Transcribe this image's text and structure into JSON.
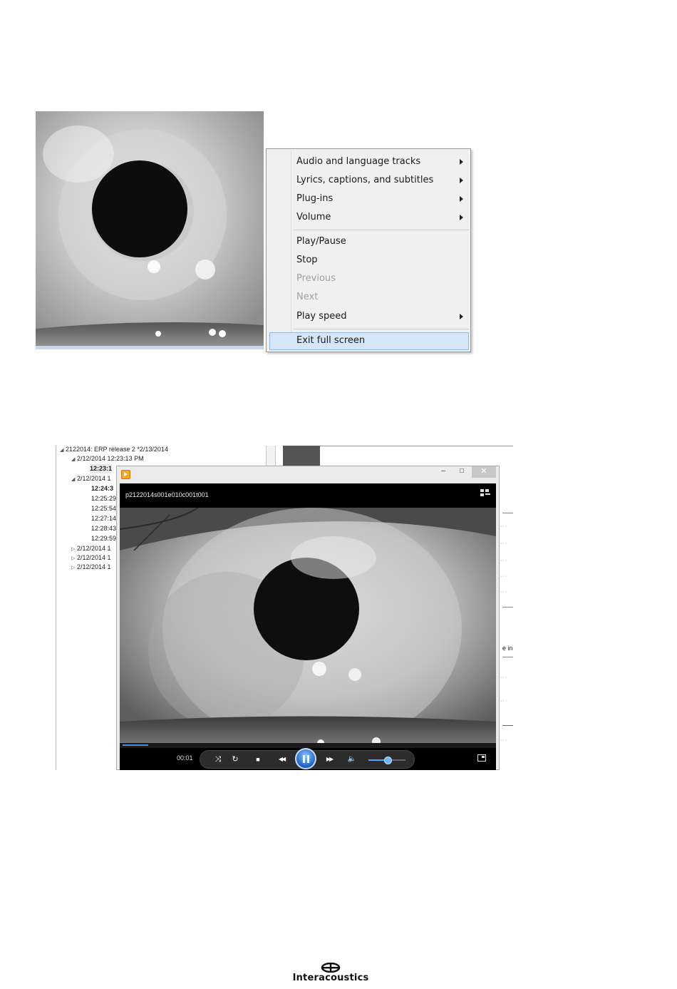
{
  "context_menu": {
    "items": [
      {
        "label": "Audio and language tracks",
        "submenu": true
      },
      {
        "label": "Lyrics, captions, and subtitles",
        "submenu": true
      },
      {
        "label": "Plug-ins",
        "submenu": true
      },
      {
        "label": "Volume",
        "submenu": true
      },
      {
        "label": "Play/Pause"
      },
      {
        "label": "Stop"
      },
      {
        "label": "Previous",
        "disabled": true
      },
      {
        "label": "Next",
        "disabled": true
      },
      {
        "label": "Play speed",
        "submenu": true
      },
      {
        "label": "Exit full screen",
        "highlighted": true
      }
    ]
  },
  "tree": {
    "root": "2122014: ERP release 2 *2/13/2014",
    "session1": "2/12/2014 12:23:13 PM",
    "session1_child": "12:23:1",
    "session2": "2/12/2014 1",
    "session2_children": [
      "12:24:3",
      "12:25:29",
      "12:25:54",
      "12:27:14",
      "12:28:43",
      "12:29:59"
    ],
    "more_sessions": [
      "2/12/2014 1",
      "2/12/2014 1",
      "2/12/2014 1"
    ]
  },
  "right_panel": {
    "partial_text": "e in"
  },
  "player": {
    "window_buttons": {
      "minimize": "–",
      "maximize": "□",
      "close": "✕"
    },
    "video_title": "p2122014s001e010c001t001",
    "time": "00:01",
    "progress": 0.07,
    "volume": 0.5,
    "icons": [
      "shuffle-icon",
      "repeat-icon",
      "stop-icon",
      "previous-icon",
      "pause-icon",
      "next-icon",
      "volume-icon",
      "switch-to-library-icon",
      "fullscreen-icon"
    ],
    "buttons": {
      "shuffle": "⤨",
      "repeat": "↻",
      "stop": "■",
      "previous": "◀◀",
      "next": "▶▶",
      "mute": "🔈"
    }
  },
  "logo": {
    "text": "Interacoustics"
  },
  "colors": {
    "menu_highlight": "#d4e6f8",
    "accent": "#1f63c7"
  }
}
